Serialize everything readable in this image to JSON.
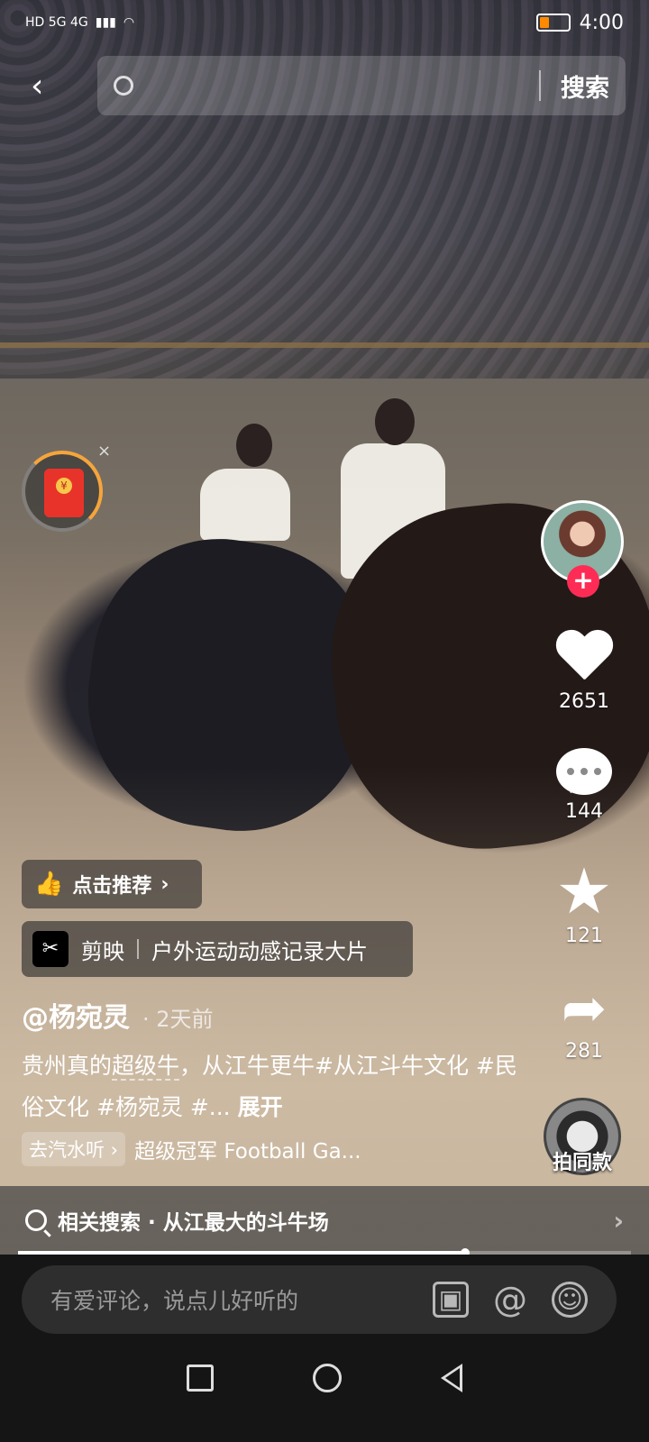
{
  "status_bar": {
    "network_left": "HD 5G 4G",
    "time": "4:00"
  },
  "search": {
    "button": "搜索"
  },
  "right_rail": {
    "likes": "2651",
    "comments": "144",
    "favorites": "121",
    "shares": "281",
    "follow_symbol": "+",
    "same_style": "拍同款"
  },
  "recommend": {
    "label": "点击推荐",
    "arrow": "›"
  },
  "capcut": {
    "app": "剪映",
    "title": "户外运动动感记录大片"
  },
  "post": {
    "author": "@杨宛灵",
    "time": "· 2天前",
    "desc_part1": "贵州真的",
    "desc_underlined": "超级牛",
    "desc_part2": "，从江牛更牛#从江斗牛文化 #民俗文化 #杨宛灵 #...",
    "desc_more": "展开"
  },
  "music": {
    "tag": "去汽水听 ›",
    "song": "超级冠军 Football Ga..."
  },
  "related_search": {
    "text": "相关搜索 · 从江最大的斗牛场",
    "arrow": "›"
  },
  "progress": {
    "fraction": 0.73
  },
  "comment": {
    "placeholder": "有爱评论，说点儿好听的",
    "at": "@"
  },
  "icons": {
    "back": "chevron-left-icon",
    "search": "magnifier-icon",
    "like": "heart-icon",
    "comment": "chat-bubble-icon",
    "favorite": "star-icon",
    "share": "share-arrow-icon",
    "image": "image-icon",
    "emoji": "emoji-icon"
  },
  "colors": {
    "accent": "#fe2c55",
    "red_packet": "#e8332a",
    "ring": "#f6a53a"
  }
}
